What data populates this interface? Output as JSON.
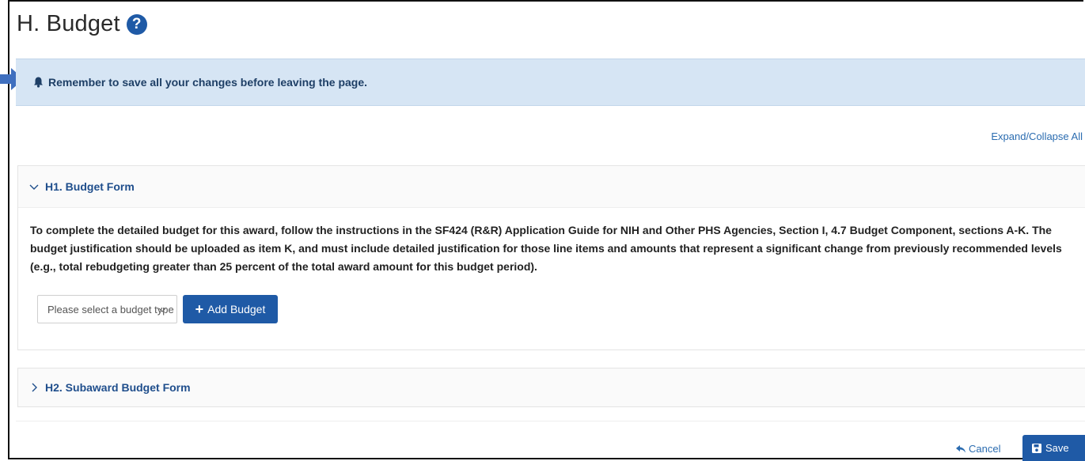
{
  "page": {
    "title": "H. Budget",
    "help_icon": "question-circle-icon"
  },
  "alert": {
    "icon": "bell-icon",
    "text": "Remember to save all your changes before leaving the page."
  },
  "expand_collapse_label": "Expand/Collapse All",
  "sections": {
    "h1": {
      "title": "H1. Budget Form",
      "expanded": true,
      "description": "To complete the detailed budget for this award, follow the instructions in the SF424 (R&R) Application Guide for NIH and Other PHS Agencies, Section I, 4.7 Budget Component, sections A-K. The budget justification should be uploaded as item K, and must include detailed justification for those line items and amounts that represent a significant change from previously recommended levels (e.g., total rebudgeting greater than 25 percent of the total award amount for this budget period).",
      "budget_type_placeholder": "Please select a budget type",
      "add_button_label": "Add Budget"
    },
    "h2": {
      "title": "H2. Subaward Budget Form",
      "expanded": false
    }
  },
  "footer": {
    "cancel_label": "Cancel",
    "save_label": "Save"
  },
  "colors": {
    "primary": "#1f5aa6",
    "alert_bg": "#d6e5f4",
    "link": "#2b6cb0"
  }
}
